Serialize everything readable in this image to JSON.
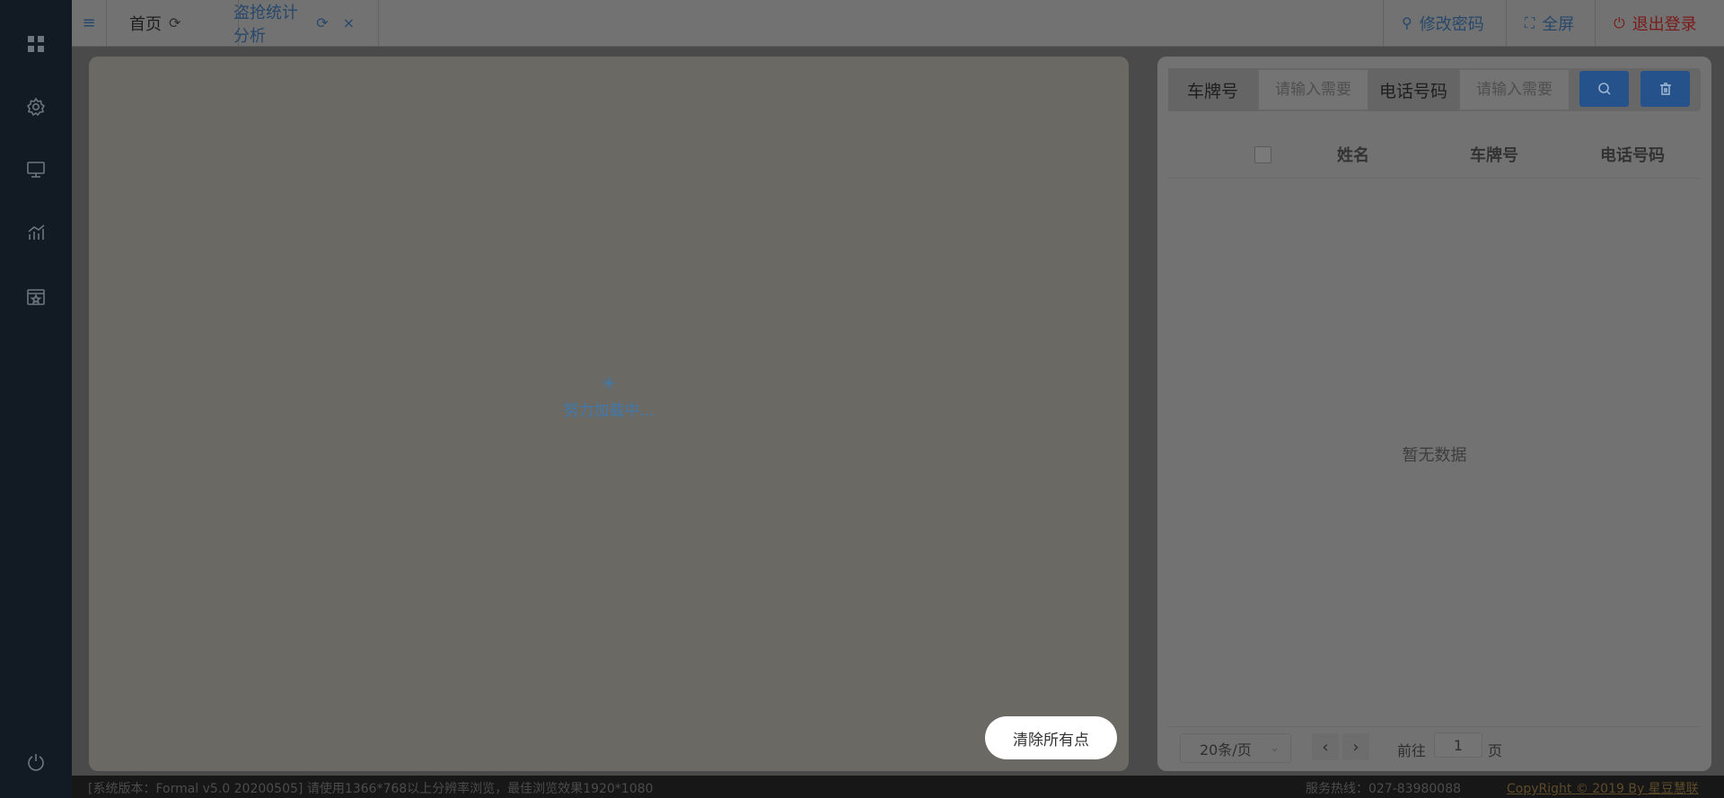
{
  "sidebar": {
    "icons": [
      "dashboard-icon",
      "settings-icon",
      "monitor-icon",
      "statistics-icon",
      "calendar-star-icon",
      "power-icon"
    ]
  },
  "header": {
    "menu_icon": "hamburger-icon",
    "tabs": [
      {
        "label": "首页",
        "icon": "refresh-icon"
      },
      {
        "label": "盗抢统计分析",
        "icon": "refresh-icon",
        "close": "×"
      }
    ],
    "actions": {
      "change_password": "修改密码",
      "fullscreen": "全屏",
      "logout": "退出登录"
    }
  },
  "map": {
    "loading_text": "努力加载中...",
    "clear_button": "清除所有点"
  },
  "search": {
    "plate_label": "车牌号",
    "plate_placeholder": "请输入需要",
    "phone_label": "电话号码",
    "phone_placeholder": "请输入需要"
  },
  "table": {
    "columns": [
      "姓名",
      "车牌号",
      "电话号码"
    ],
    "empty_text": "暂无数据"
  },
  "pagination": {
    "page_size": "20条/页",
    "goto_label": "前往",
    "current_page": "1",
    "page_unit": "页"
  },
  "footer": {
    "version": "[系统版本：Formal v5.0 20200505] 请使用1366*768以上分辨率浏览，最佳浏览效果1920*1080",
    "hotline": "服务热线：027-83980088",
    "copyright": "CopyRight © 2019 By 星豆慧联"
  },
  "colors": {
    "sidebar": "#121b24",
    "primary_button": "#25528a",
    "active_tab": "#27486b",
    "logout": "#7a1b1b"
  }
}
